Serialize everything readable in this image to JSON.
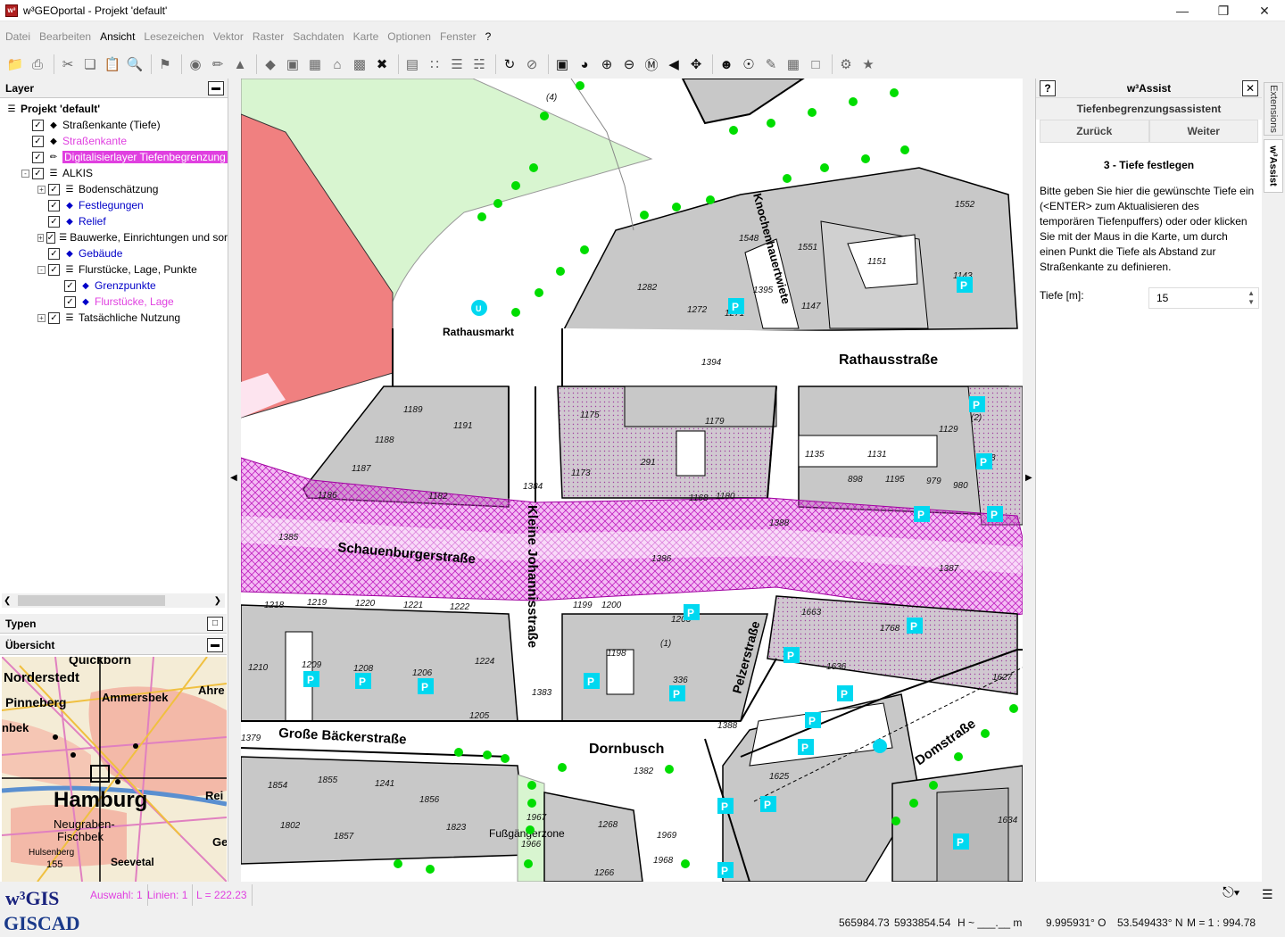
{
  "window": {
    "title": "w³GEOportal - Projekt 'default'",
    "app_icon": "w³"
  },
  "menu": [
    "Datei",
    "Bearbeiten",
    "Ansicht",
    "Lesezeichen",
    "Vektor",
    "Raster",
    "Sachdaten",
    "Karte",
    "Optionen",
    "Fenster",
    "?"
  ],
  "menu_active": "Ansicht",
  "layer_panel": {
    "title": "Layer",
    "items": [
      {
        "label": "Projekt 'default'",
        "level": 0,
        "exp": "",
        "cb": false,
        "icon": "layers-icon",
        "style": "bold"
      },
      {
        "label": "Straßenkante (Tiefe)",
        "level": 1,
        "exp": "",
        "cb": true,
        "icon": "diamond-icon",
        "style": ""
      },
      {
        "label": "Straßenkante",
        "level": 1,
        "exp": "",
        "cb": true,
        "icon": "diamond-icon",
        "style": "pink"
      },
      {
        "label": "Digitalisierlayer Tiefenbegrenzung",
        "level": 1,
        "exp": "",
        "cb": true,
        "icon": "pencil-icon",
        "style": "hl"
      },
      {
        "label": "ALKIS",
        "level": 1,
        "exp": "-",
        "cb": true,
        "icon": "layers-icon",
        "style": ""
      },
      {
        "label": "Bodenschätzung",
        "level": 2,
        "exp": "+",
        "cb": true,
        "icon": "layers-icon",
        "style": ""
      },
      {
        "label": "Festlegungen",
        "level": 2,
        "exp": "",
        "cb": true,
        "icon": "diamond-blue-icon",
        "style": "blue"
      },
      {
        "label": "Relief",
        "level": 2,
        "exp": "",
        "cb": true,
        "icon": "diamond-blue-icon",
        "style": "blue"
      },
      {
        "label": "Bauwerke, Einrichtungen und sor",
        "level": 2,
        "exp": "+",
        "cb": true,
        "icon": "layers-icon",
        "style": ""
      },
      {
        "label": "Gebäude",
        "level": 2,
        "exp": "",
        "cb": true,
        "icon": "diamond-blue-icon",
        "style": "blue"
      },
      {
        "label": "Flurstücke, Lage, Punkte",
        "level": 2,
        "exp": "-",
        "cb": true,
        "icon": "layers-icon",
        "style": ""
      },
      {
        "label": "Grenzpunkte",
        "level": 3,
        "exp": "",
        "cb": true,
        "icon": "diamond-blue-icon",
        "style": "blue"
      },
      {
        "label": "Flurstücke, Lage",
        "level": 3,
        "exp": "",
        "cb": true,
        "icon": "diamond-blue-icon",
        "style": "pink"
      },
      {
        "label": "Tatsächliche Nutzung",
        "level": 2,
        "exp": "+",
        "cb": true,
        "icon": "layers-icon",
        "style": ""
      }
    ]
  },
  "typen_panel": {
    "title": "Typen"
  },
  "overview_panel": {
    "title": "Übersicht",
    "labels": [
      "Quickborn",
      "Norderstedt",
      "Pinneberg",
      "Ammersbek",
      "Ahre",
      "Hamburg",
      "Neugraben-",
      "Fischbek",
      "Rei",
      "Ge",
      "Hulsenberg",
      "Seevetal",
      "155",
      "nbek"
    ]
  },
  "map": {
    "streets": [
      "Rathausmarkt",
      "Rathausstraße",
      "Schauenburgerstraße",
      "Kleine Johannisstraße",
      "Knochenhauertwiete",
      "Pelzerstraße",
      "Große Bäckerstraße",
      "Dornbusch",
      "Domstraße",
      "Fußgängerzone"
    ],
    "parcels": [
      "1282",
      "1272",
      "1271",
      "1395",
      "1147",
      "1548",
      "1551",
      "1151",
      "1552",
      "1143",
      "1394",
      "1189",
      "1191",
      "1188",
      "1187",
      "1186",
      "1182",
      "1384",
      "1175",
      "1179",
      "1173",
      "291",
      "1168",
      "1180",
      "1129",
      "1135",
      "1131",
      "898",
      "1195",
      "979",
      "980",
      "1128",
      "1385",
      "1386",
      "1387",
      "1388",
      "1218",
      "1219",
      "1220",
      "1221",
      "1222",
      "1199",
      "1200",
      "1203",
      "1663",
      "1768",
      "1210",
      "1209",
      "1208",
      "1206",
      "1224",
      "1198",
      "1205",
      "1383",
      "336",
      "1636",
      "1627",
      "1379",
      "1388",
      "1854",
      "1855",
      "1241",
      "1856",
      "1382",
      "1625",
      "1802",
      "1857",
      "1823",
      "1967",
      "1966",
      "1268",
      "1969",
      "1968",
      "1266",
      "1634",
      "(1)",
      "(2)",
      "(4)"
    ]
  },
  "assist": {
    "title": "w³Assist",
    "subtitle": "Tiefenbegrenzungsassistent",
    "back_label": "Zurück",
    "next_label": "Weiter",
    "step_title": "3 - Tiefe festlegen",
    "description": "Bitte geben Sie hier die gewünschte Tiefe ein (<ENTER> zum Aktualisieren des temporären Tiefenpuffers) oder oder klicken Sie mit der Maus in die Karte, um durch einen Punkt die Tiefe als Abstand zur Straßenkante zu definieren.",
    "depth_label": "Tiefe [m]:",
    "depth_value": "15"
  },
  "side_tabs": [
    "Extensions",
    "w³Assist"
  ],
  "status": {
    "logo_top": "w³GIS",
    "logo_bottom": "GISCAD",
    "auswahl": "Auswahl: 1",
    "linien": "Linien: 1",
    "length": "L = 222.23",
    "x": "565984.73",
    "y": "5933854.54",
    "height": "H ~ ___.__ m",
    "lon": "9.995931° O",
    "lat": "53.549433° N",
    "scale": "M = 1 : 994.78"
  },
  "colors": {
    "magenta": "#e040e0",
    "building": "#c8c8c8",
    "red_building": "#f08080",
    "park": "#d8f5d0",
    "parking": "#00d8f0",
    "tree": "#00dd00"
  }
}
